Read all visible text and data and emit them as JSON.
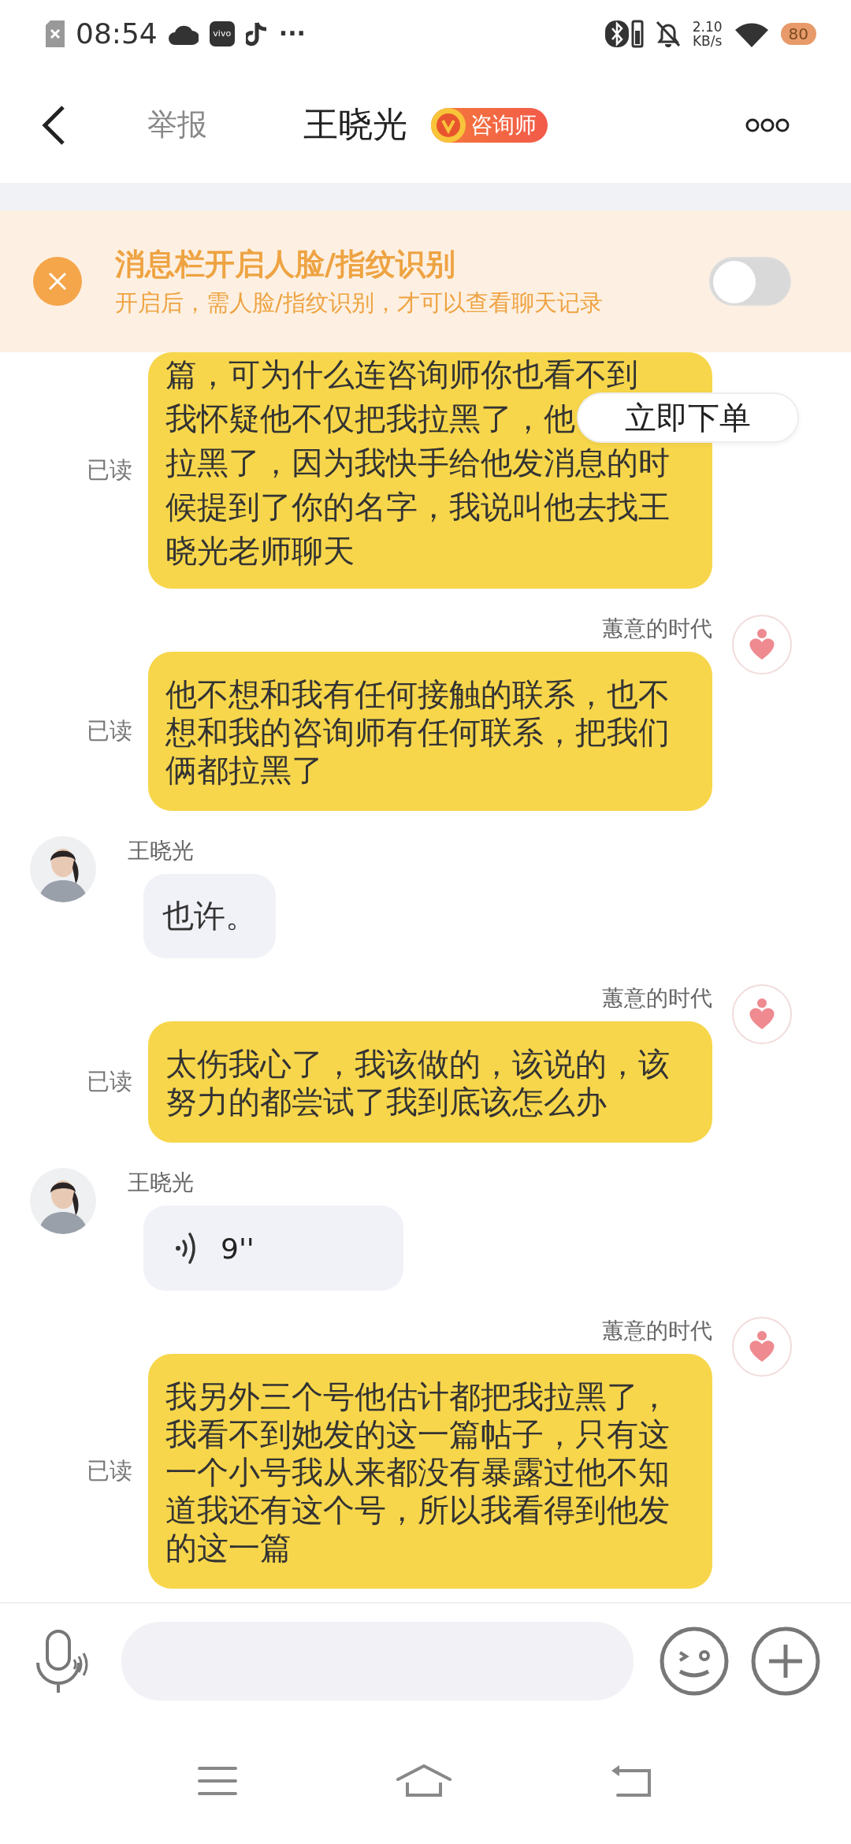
{
  "status_bar": {
    "time": "08:54",
    "app_label": "vivo",
    "more": "···",
    "net_speed": "2.10",
    "net_unit": "KB/s",
    "badge": "80"
  },
  "header": {
    "report": "举报",
    "title": "王晓光",
    "badge": "咨询师"
  },
  "banner": {
    "title": "消息栏开启人脸/指纹识别",
    "subtitle": "开启后，需人脸/指纹识别，才可以查看聊天记录",
    "toggle_on": false
  },
  "order_button": "立即下单",
  "messages": [
    {
      "kind": "outgoing",
      "lines": [
        "篇，可为什么连咨询师你也看不到",
        "我怀疑他不仅把我拉黑了，他",
        "拉黑了，因为我快手给他发消息的时",
        "候提到了你的名字，我说叫他去找王",
        "晓光老师聊天"
      ],
      "read_label": "已读"
    },
    {
      "kind": "outgoing",
      "sender": "蕙意的时代",
      "lines": [
        "他不想和我有任何接触的联系，也不",
        "想和我的咨询师有任何联系，把我们",
        "俩都拉黑了"
      ],
      "read_label": "已读"
    },
    {
      "kind": "incoming",
      "sender": "王晓光",
      "lines": [
        "也许。"
      ]
    },
    {
      "kind": "outgoing",
      "sender": "蕙意的时代",
      "lines": [
        "太伤我心了，我该做的，该说的，该",
        "努力的都尝试了我到底该怎么办"
      ],
      "read_label": "已读"
    },
    {
      "kind": "voice",
      "sender": "王晓光",
      "duration": "9''"
    },
    {
      "kind": "outgoing",
      "sender": "蕙意的时代",
      "lines": [
        "我另外三个号他估计都把我拉黑了，",
        "我看不到她发的这一篇帖子，只有这",
        "一个小号我从来都没有暴露过他不知",
        "道我还有这个号，所以我看得到他发",
        "的这一篇"
      ],
      "read_label": "已读"
    }
  ]
}
